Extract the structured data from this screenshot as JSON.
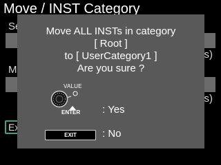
{
  "screen": {
    "title": "Move / INST Category"
  },
  "background": {
    "top_label": "Se",
    "top_suffix": "s)",
    "mid_label": "M",
    "mid_suffix": "s)",
    "exit_label": "Ex"
  },
  "dialog": {
    "line1": "Move ALL INSTs in category",
    "line2": "[ Root ]",
    "line3": "to [ UserCategory1 ]",
    "line4": "Are you sure ?",
    "knob_label": "VALUE",
    "enter_label": "ENTER",
    "yes_label": ": Yes",
    "exit_button_label": "EXIT",
    "no_label": ": No"
  },
  "colors": {
    "background": "#000000",
    "dialog": "#595959",
    "field": "#6b6b6b",
    "accent": "#3aa48a",
    "text": "#ffffff"
  },
  "icons": {
    "knob": "value-knob-icon",
    "enter_arrow": "enter-arrow-icon"
  }
}
